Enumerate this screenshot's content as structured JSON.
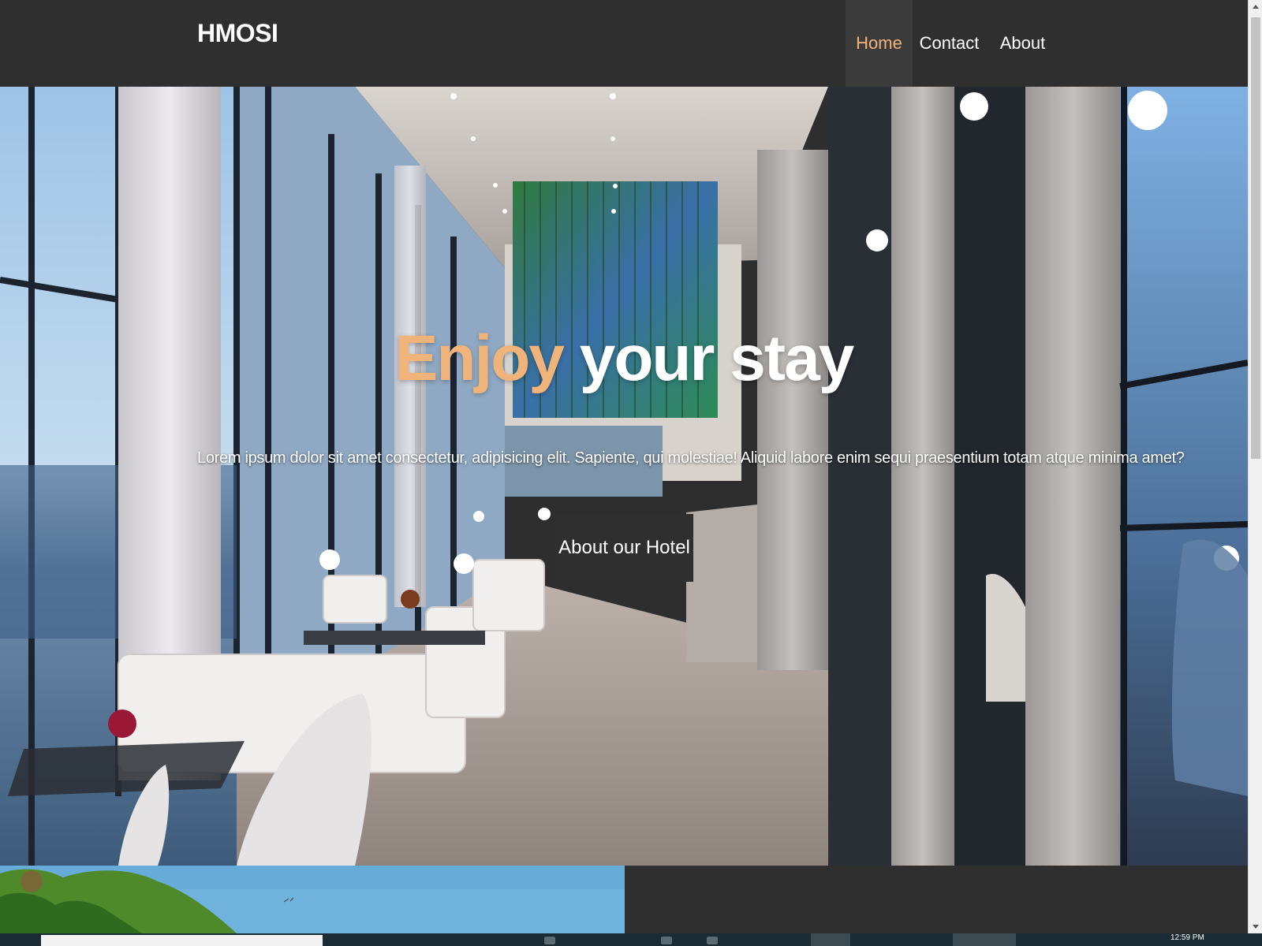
{
  "header": {
    "brand": "HMOSI",
    "nav": [
      {
        "label": "Home",
        "active": true
      },
      {
        "label": "Contact",
        "active": false
      },
      {
        "label": "About",
        "active": false
      }
    ]
  },
  "hero": {
    "title_accent": "Enjoy",
    "title_rest": " your stay",
    "text": "Lorem ipsum dolor sit amet consectetur, adipisicing elit. Sapiente, qui molestiae! Aliquid labore enim sequi praesentium totam atque minima amet?",
    "button_label": "About our Hotel"
  },
  "colors": {
    "accent": "#f0b47a",
    "dark": "#2f2f2f"
  },
  "taskbar": {
    "clock": "12:59 PM"
  }
}
